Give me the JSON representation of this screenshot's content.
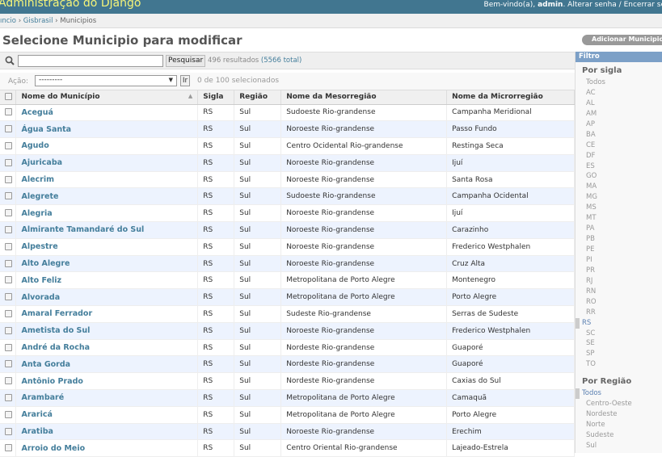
{
  "header": {
    "site_name": "Administração do Django",
    "welcome": "Bem-vindo(a),",
    "username": "admin",
    "links": ". Alterar senha / Encerrar se"
  },
  "breadcrumbs": {
    "home": "ıncio",
    "app": "Gisbrasil",
    "current": "Municipios",
    "sep": "›"
  },
  "page_title": "Selecione Municipio para modificar",
  "add_button": "Adicionar Municipio",
  "search": {
    "placeholder": "",
    "button": "Pesquisar",
    "results": "496 resultados",
    "total": "(5566 total)"
  },
  "actions": {
    "label": "Ação:",
    "selected": "---------",
    "go": "Ir",
    "counter": "0 de 100 selecionados"
  },
  "columns": [
    "Nome do Município",
    "Sigla",
    "Região",
    "Nome da Mesorregião",
    "Nome da Microrregião"
  ],
  "rows": [
    {
      "name": "Aceguá",
      "sigla": "RS",
      "regiao": "Sul",
      "meso": "Sudoeste Rio-grandense",
      "micro": "Campanha Meridional"
    },
    {
      "name": "Água Santa",
      "sigla": "RS",
      "regiao": "Sul",
      "meso": "Noroeste Rio-grandense",
      "micro": "Passo Fundo"
    },
    {
      "name": "Agudo",
      "sigla": "RS",
      "regiao": "Sul",
      "meso": "Centro Ocidental Rio-grandense",
      "micro": "Restinga Seca"
    },
    {
      "name": "Ajuricaba",
      "sigla": "RS",
      "regiao": "Sul",
      "meso": "Noroeste Rio-grandense",
      "micro": "Ijuí"
    },
    {
      "name": "Alecrim",
      "sigla": "RS",
      "regiao": "Sul",
      "meso": "Noroeste Rio-grandense",
      "micro": "Santa Rosa"
    },
    {
      "name": "Alegrete",
      "sigla": "RS",
      "regiao": "Sul",
      "meso": "Sudoeste Rio-grandense",
      "micro": "Campanha Ocidental"
    },
    {
      "name": "Alegria",
      "sigla": "RS",
      "regiao": "Sul",
      "meso": "Noroeste Rio-grandense",
      "micro": "Ijuí"
    },
    {
      "name": "Almirante Tamandaré do Sul",
      "sigla": "RS",
      "regiao": "Sul",
      "meso": "Noroeste Rio-grandense",
      "micro": "Carazinho"
    },
    {
      "name": "Alpestre",
      "sigla": "RS",
      "regiao": "Sul",
      "meso": "Noroeste Rio-grandense",
      "micro": "Frederico Westphalen"
    },
    {
      "name": "Alto Alegre",
      "sigla": "RS",
      "regiao": "Sul",
      "meso": "Noroeste Rio-grandense",
      "micro": "Cruz Alta"
    },
    {
      "name": "Alto Feliz",
      "sigla": "RS",
      "regiao": "Sul",
      "meso": "Metropolitana de Porto Alegre",
      "micro": "Montenegro"
    },
    {
      "name": "Alvorada",
      "sigla": "RS",
      "regiao": "Sul",
      "meso": "Metropolitana de Porto Alegre",
      "micro": "Porto Alegre"
    },
    {
      "name": "Amaral Ferrador",
      "sigla": "RS",
      "regiao": "Sul",
      "meso": "Sudeste Rio-grandense",
      "micro": "Serras de Sudeste"
    },
    {
      "name": "Ametista do Sul",
      "sigla": "RS",
      "regiao": "Sul",
      "meso": "Noroeste Rio-grandense",
      "micro": "Frederico Westphalen"
    },
    {
      "name": "André da Rocha",
      "sigla": "RS",
      "regiao": "Sul",
      "meso": "Nordeste Rio-grandense",
      "micro": "Guaporé"
    },
    {
      "name": "Anta Gorda",
      "sigla": "RS",
      "regiao": "Sul",
      "meso": "Nordeste Rio-grandense",
      "micro": "Guaporé"
    },
    {
      "name": "Antônio Prado",
      "sigla": "RS",
      "regiao": "Sul",
      "meso": "Nordeste Rio-grandense",
      "micro": "Caxias do Sul"
    },
    {
      "name": "Arambaré",
      "sigla": "RS",
      "regiao": "Sul",
      "meso": "Metropolitana de Porto Alegre",
      "micro": "Camaquã"
    },
    {
      "name": "Araricá",
      "sigla": "RS",
      "regiao": "Sul",
      "meso": "Metropolitana de Porto Alegre",
      "micro": "Porto Alegre"
    },
    {
      "name": "Aratiba",
      "sigla": "RS",
      "regiao": "Sul",
      "meso": "Noroeste Rio-grandense",
      "micro": "Erechim"
    },
    {
      "name": "Arroio do Meio",
      "sigla": "RS",
      "regiao": "Sul",
      "meso": "Centro Oriental Rio-grandense",
      "micro": "Lajeado-Estrela"
    }
  ],
  "filter": {
    "title": "Filtro",
    "sigla_heading": "Por sigla",
    "sigla_options": [
      "Todos",
      "AC",
      "AL",
      "AM",
      "AP",
      "BA",
      "CE",
      "DF",
      "ES",
      "GO",
      "MA",
      "MG",
      "MS",
      "MT",
      "PA",
      "PB",
      "PE",
      "PI",
      "PR",
      "RJ",
      "RN",
      "RO",
      "RR",
      "RS",
      "SC",
      "SE",
      "SP",
      "TO"
    ],
    "sigla_selected": "RS",
    "regiao_heading": "Por Região",
    "regiao_options": [
      "Todos",
      "Centro-Oeste",
      "Nordeste",
      "Norte",
      "Sudeste",
      "Sul"
    ],
    "regiao_selected": "Todos"
  }
}
